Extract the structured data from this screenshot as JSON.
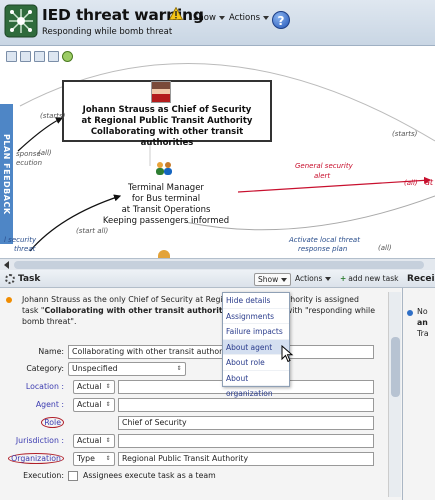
{
  "header": {
    "title": "IED threat warning",
    "subtitle": "Responding while bomb threat",
    "show_label": "Show",
    "actions_label": "Actions",
    "help_label": "?"
  },
  "map": {
    "plan_feedback": "PLAN FEEDBACK",
    "main_node": [
      "Johann Strauss as Chief of Security",
      "at Regional Public Transit Authority",
      "Collaborating with other transit authorities"
    ],
    "node2": [
      "Terminal Manager",
      "for Bus terminal",
      "at Transit Operations",
      "Keeping passengers informed"
    ],
    "edge_labels": {
      "starts_left": "(starts)",
      "starts_right": "(starts)",
      "response": "sponse",
      "execution": "ecution",
      "all_left": "(all)",
      "general_security": "General security",
      "alert": "alert",
      "all_red": "(all)",
      "at": "at",
      "start_all": "(start all)",
      "security_left": "l security",
      "threat_left": "threat",
      "activate_local": "Activate local threat",
      "response_plan": "response plan",
      "all_right": "(all)"
    }
  },
  "task": {
    "title": "Task",
    "show_label": "Show",
    "actions_label": "Actions",
    "add_task_label": "add new task",
    "summary_line1": "Johann Strauss as the only Chief of Security at Regio                    Authority is assigned",
    "summary_line2_pre": "task \"",
    "summary_line2_bold": "Collaborating with other transit authorities",
    "summary_line2_post": "\"                   with \"responding while",
    "summary_line3": "bomb threat\".",
    "fields": {
      "name_label": "Name:",
      "name_value": "Collaborating with other transit authoriti",
      "category_label": "Category:",
      "category_value": "Unspecified",
      "location_label": "Location :",
      "location_select": "Actual",
      "agent_label": "Agent :",
      "agent_select": "Actual",
      "role_label": "Role",
      "role_value": "Chief of Security",
      "jurisdiction_label": "Jurisdiction :",
      "jurisdiction_select": "Actual",
      "organization_label": "Organization",
      "organization_select": "Type",
      "organization_value": "Regional Public Transit Authority",
      "execution_label": "Execution:",
      "execution_checkbox_label": "Assignees execute task as a team"
    },
    "show_menu": [
      "Hide details",
      "Assignments",
      "Failure impacts",
      "About agent",
      "About role",
      "About organization"
    ],
    "show_menu_hover_index": 3
  },
  "right_panel": {
    "title": "Recei",
    "line1": "No",
    "line2": "an",
    "line3": "Tra"
  },
  "colors": {
    "plan_feedback_bg": "#4e86c6",
    "red_edge": "#c8102e",
    "blue_label": "#2a4e8c",
    "link": "#3b3bb0",
    "circle_highlight": "#b0202a"
  }
}
